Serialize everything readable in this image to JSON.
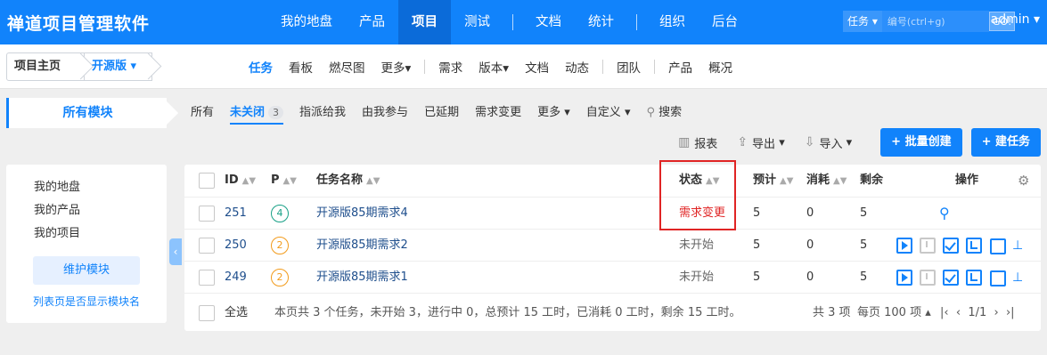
{
  "app": {
    "brand": "禅道项目管理软件",
    "user": "admin"
  },
  "mainnav": [
    "我的地盘",
    "产品",
    "项目",
    "测试",
    "文档",
    "统计",
    "组织",
    "后台"
  ],
  "search": {
    "type": "任务",
    "placeholder": "编号(ctrl+g)",
    "go": "GO!"
  },
  "breadcrumb": {
    "home": "项目主页",
    "project": "开源版"
  },
  "subnav": [
    "任务",
    "看板",
    "燃尽图",
    "更多",
    "需求",
    "版本",
    "文档",
    "动态",
    "团队",
    "产品",
    "概况"
  ],
  "module_title": "所有模块",
  "filters": {
    "all": "所有",
    "unclosed": "未关闭",
    "unclosed_count": "3",
    "assigned": "指派给我",
    "involved": "由我参与",
    "delayed": "已延期",
    "changed": "需求变更",
    "more": "更多",
    "custom": "自定义",
    "search": "搜索"
  },
  "toolbar": {
    "report": "报表",
    "export": "导出",
    "import": "导入",
    "batch_create": "+ 批量创建",
    "create": "+ 建任务"
  },
  "sidebar": {
    "items": [
      "我的地盘",
      "我的产品",
      "我的项目"
    ],
    "maintain": "维护模块",
    "toggle": "列表页是否显示模块名"
  },
  "table": {
    "headers": {
      "id": "ID",
      "pri": "P",
      "name": "任务名称",
      "status": "状态",
      "estimate": "预计",
      "consumed": "消耗",
      "left": "剩余",
      "actions": "操作"
    },
    "rows": [
      {
        "id": "251",
        "pri": "4",
        "pri_color": "#17a086",
        "name": "开源版85期需求4",
        "status": "需求变更",
        "estimate": "5",
        "consumed": "0",
        "left": "5"
      },
      {
        "id": "250",
        "pri": "2",
        "pri_color": "#f29b1b",
        "name": "开源版85期需求2",
        "status": "未开始",
        "estimate": "5",
        "consumed": "0",
        "left": "5"
      },
      {
        "id": "249",
        "pri": "2",
        "pri_color": "#f29b1b",
        "name": "开源版85期需求1",
        "status": "未开始",
        "estimate": "5",
        "consumed": "0",
        "left": "5"
      }
    ]
  },
  "footer": {
    "select_all": "全选",
    "summary": "本页共 3 个任务，未开始 3，进行中 0，总预计 15 工时，已消耗 0 工时，剩余 15 工时。",
    "total": "共 3 项",
    "per_page": "每页 100 项",
    "page": "1/1"
  }
}
